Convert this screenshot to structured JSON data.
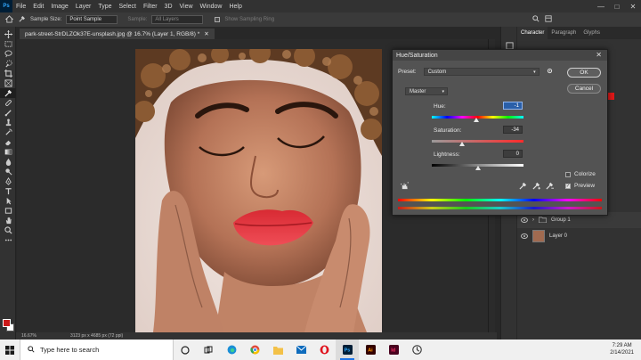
{
  "menubar": {
    "logo": "Ps",
    "items": [
      "File",
      "Edit",
      "Image",
      "Layer",
      "Type",
      "Select",
      "Filter",
      "3D",
      "View",
      "Window",
      "Help"
    ]
  },
  "options": {
    "sample_size_label": "Sample Size:",
    "sample_size_value": "Point Sample",
    "sample_label": "Sample:",
    "sample_value": "All Layers",
    "show_ring": "Show Sampling Ring"
  },
  "document": {
    "tab_title": "park-street-StrDLZOk37E-unsplash.jpg @ 16.7% (Layer 1, RGB/8) *",
    "zoom": "16.67%",
    "dimensions": "3123 px x 4685 px (72 ppi)"
  },
  "panels": {
    "tabs": [
      "Character",
      "Paragraph",
      "Glyphs"
    ],
    "layers": [
      {
        "name": "Group 1"
      },
      {
        "name": "Layer 0"
      }
    ]
  },
  "dialog": {
    "title": "Hue/Saturation",
    "preset_label": "Preset:",
    "preset_value": "Custom",
    "channel": "Master",
    "ok": "OK",
    "cancel": "Cancel",
    "hue_label": "Hue:",
    "hue_value": "-1",
    "saturation_label": "Saturation:",
    "saturation_value": "-34",
    "lightness_label": "Lightness:",
    "lightness_value": "0",
    "colorize_label": "Colorize",
    "preview_label": "Preview",
    "colorize_checked": false,
    "preview_checked": true
  },
  "taskbar": {
    "search_placeholder": "Type here to search",
    "time": "7:29 AM",
    "date": "2/14/2021"
  },
  "colors": {
    "foreground": "#cc1a1a",
    "background": "#ffffff",
    "lip_sample": "#e3222b",
    "ps_blue": "#31a8ff"
  }
}
